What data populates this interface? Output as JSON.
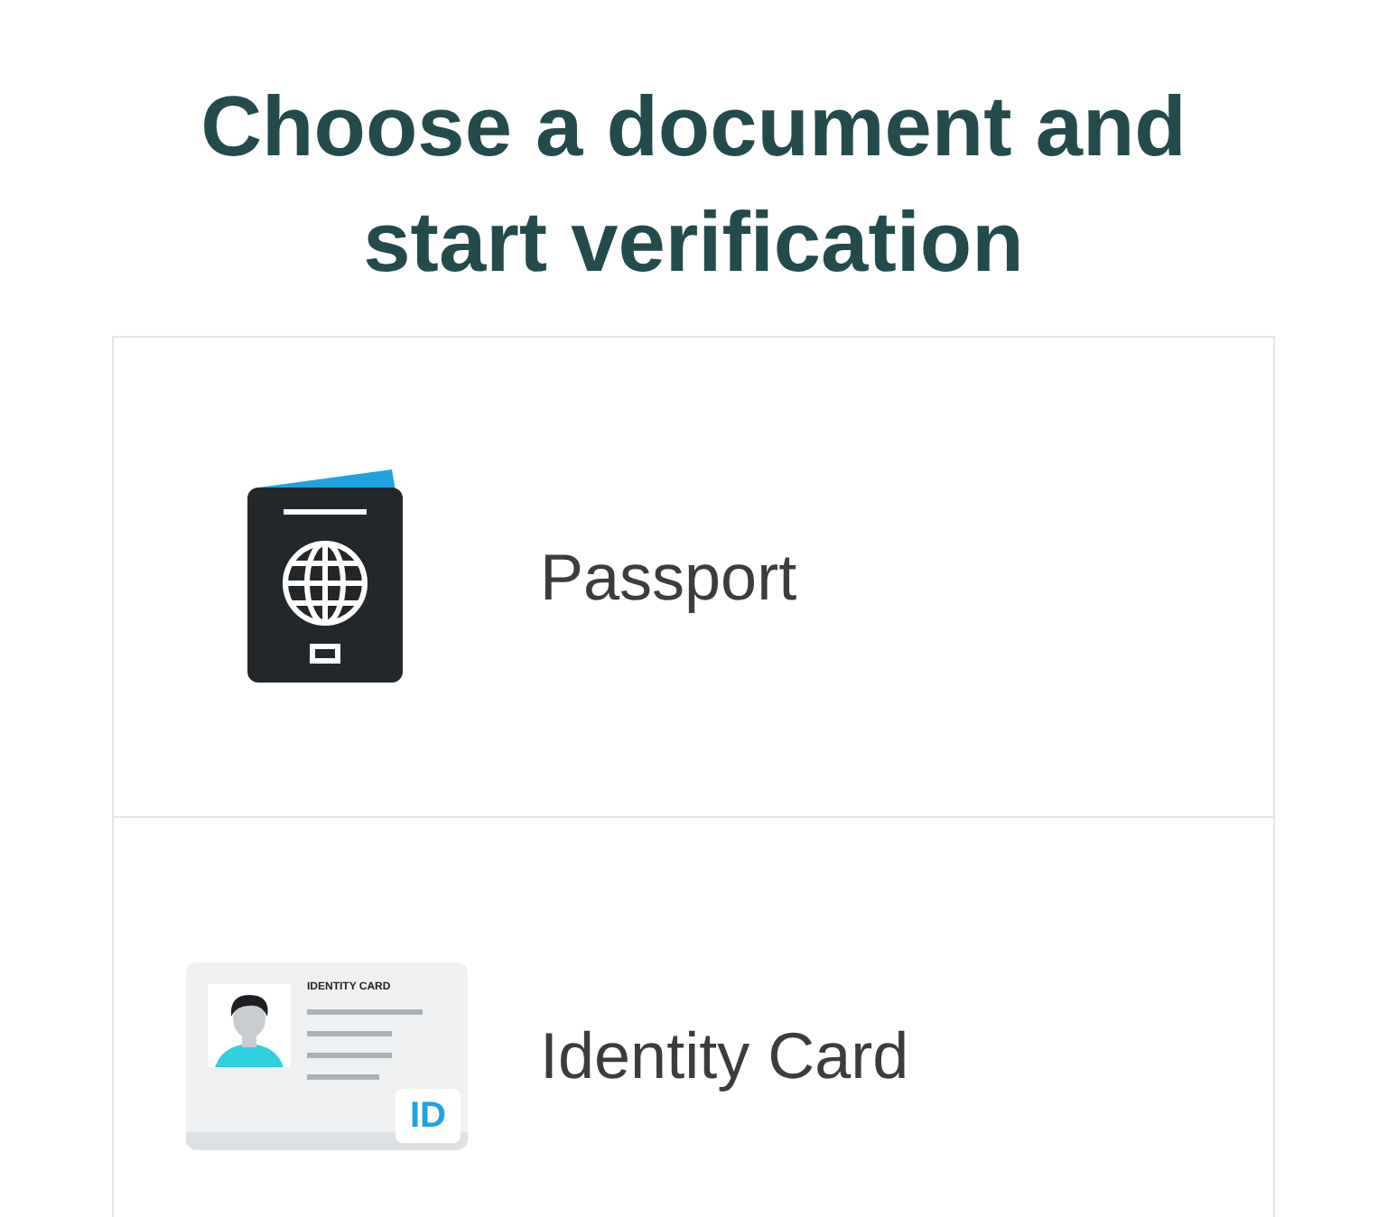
{
  "title": "Choose a document and start verification",
  "documents": [
    {
      "kind": "passport",
      "label": "Passport"
    },
    {
      "kind": "id_card",
      "label": "Identity Card",
      "card_heading": "IDENTITY CARD",
      "badge": "ID"
    }
  ]
}
